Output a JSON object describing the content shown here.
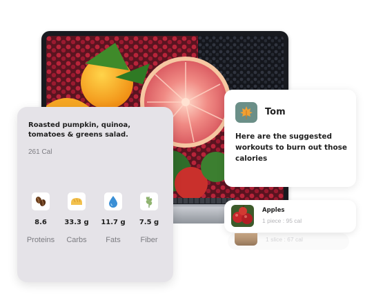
{
  "meal": {
    "title": "Roasted pumpkin, quinoa, tomatoes & greens salad.",
    "calories": "261 Cal",
    "nutrients": [
      {
        "icon": "coffee-beans-icon",
        "value": "8.6",
        "label": "Proteins"
      },
      {
        "icon": "bread-icon",
        "value": "33.3 g",
        "label": "Carbs"
      },
      {
        "icon": "water-drop-icon",
        "value": "11.7 g",
        "label": "Fats"
      },
      {
        "icon": "wheat-icon",
        "value": "7.5 g",
        "label": "Fiber"
      }
    ]
  },
  "chat": {
    "avatar_icon": "maple-leaf-icon",
    "name": "Tom",
    "message": "Here are the suggested workouts to burn out those calories"
  },
  "foods": [
    {
      "icon": "apples-thumbnail",
      "name": "Apples",
      "meta": "1 piece : 95 cal"
    },
    {
      "icon": "bread-slice-thumbnail",
      "name": "",
      "meta": "1 slice : 67 cal"
    }
  ],
  "colors": {
    "meal_card_bg": "#e5e3e8",
    "avatar_bg": "#6b8f88",
    "text_dark": "#1f1f1f",
    "text_muted": "#7b7b80"
  }
}
